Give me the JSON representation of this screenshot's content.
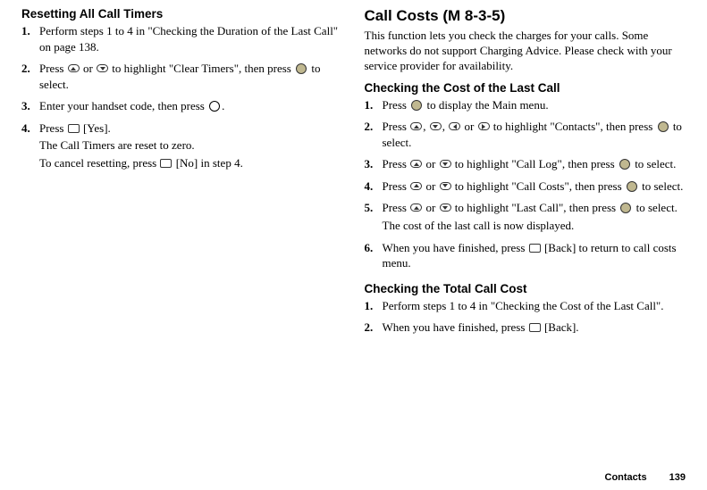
{
  "left": {
    "heading": "Resetting All Call Timers",
    "steps": [
      {
        "text_a": "Perform steps 1 to 4 in \"Checking the Duration of the Last Call\" on page 138."
      },
      {
        "text_a": "Press ",
        "text_b": " or ",
        "text_c": " to highlight \"Clear Timers\", then press ",
        "text_d": " to select."
      },
      {
        "text_a": "Enter your handset code, then press ",
        "text_b": "."
      },
      {
        "text_a": "Press ",
        "text_b": " [Yes].",
        "sub1": "The Call Timers are reset to zero.",
        "sub2_a": "To cancel resetting, press ",
        "sub2_b": " [No] in step 4."
      }
    ]
  },
  "right": {
    "heading": "Call Costs",
    "code": "(M 8-3-5)",
    "intro": "This function lets you check the charges for your calls. Some networks do not support Charging Advice. Please check with your service provider for availability.",
    "section1": {
      "heading": "Checking the Cost of the Last Call",
      "steps": [
        {
          "text_a": "Press ",
          "text_b": " to display the Main menu."
        },
        {
          "text_a": "Press ",
          "text_b": ", ",
          "text_c": ", ",
          "text_d": " or ",
          "text_e": " to highlight \"Contacts\", then press ",
          "text_f": " to select."
        },
        {
          "text_a": "Press ",
          "text_b": " or ",
          "text_c": " to highlight \"Call Log\", then press ",
          "text_d": " to select."
        },
        {
          "text_a": "Press ",
          "text_b": " or ",
          "text_c": " to highlight \"Call Costs\", then press ",
          "text_d": " to select."
        },
        {
          "text_a": "Press ",
          "text_b": " or ",
          "text_c": " to highlight \"Last Call\", then press ",
          "text_d": " to select.",
          "sub": "The cost of the last call is now displayed."
        },
        {
          "text_a": "When you have finished, press ",
          "text_b": " [Back] to return to call costs menu."
        }
      ]
    },
    "section2": {
      "heading": "Checking the Total Call Cost",
      "steps": [
        {
          "text_a": "Perform steps 1 to 4 in \"Checking the Cost of the Last Call\"."
        },
        {
          "text_a": "When you have finished, press ",
          "text_b": " [Back]."
        }
      ]
    }
  },
  "footer": {
    "label": "Contacts",
    "page": "139"
  }
}
